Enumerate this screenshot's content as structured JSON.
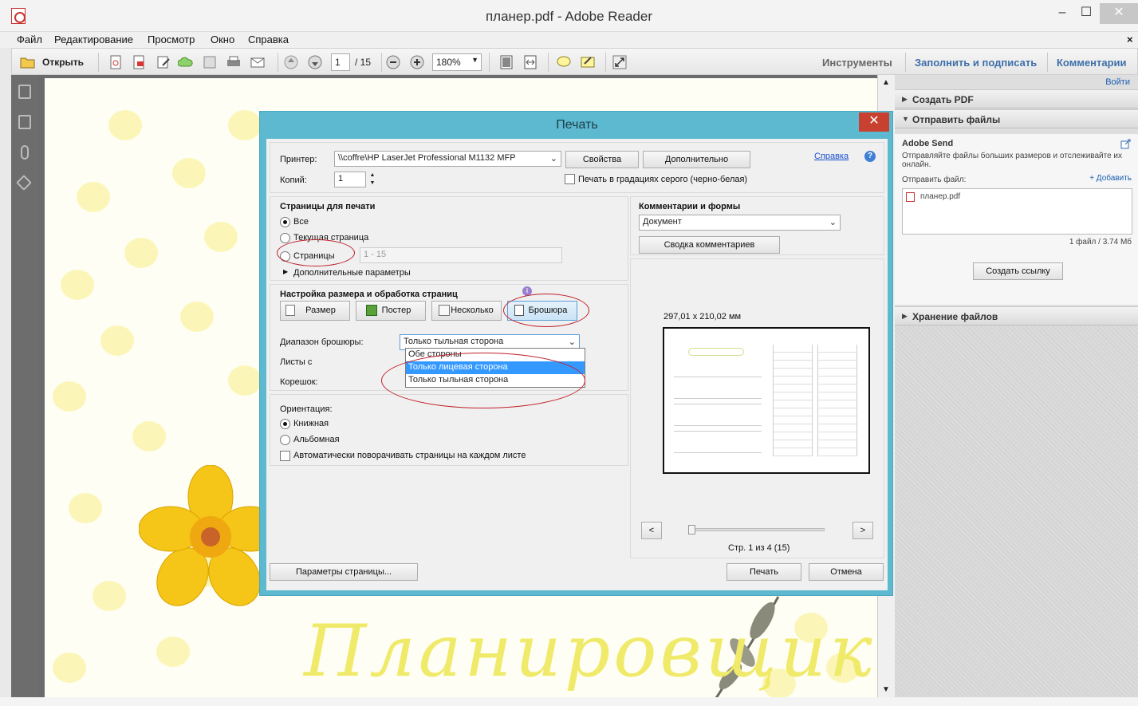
{
  "window": {
    "title": "планер.pdf - Adobe Reader",
    "minimize": "–",
    "maximize": "☐",
    "close": "✕"
  },
  "menu": [
    "Файл",
    "Редактирование",
    "Просмотр",
    "Окно",
    "Справка"
  ],
  "menu_close": "×",
  "toolbar": {
    "open_label": "Открыть",
    "page_current": "1",
    "page_total": "/ 15",
    "zoom": "180%",
    "tools": "Инструменты",
    "fill_sign": "Заполнить и подписать",
    "comments": "Комментарии"
  },
  "document": {
    "cover_word": "Планировщик"
  },
  "right_panel": {
    "login": "Войти",
    "create_pdf": "Создать PDF",
    "send_files": "Отправить файлы",
    "adobe_send_title": "Adobe Send",
    "adobe_send_desc": "Отправляйте файлы больших размеров и отслеживайте их онлайн.",
    "send_file_label": "Отправить файл:",
    "add_link": "+ Добавить",
    "file_name": "планер.pdf",
    "file_count": "1 файл / 3.74 Мб",
    "create_link_button": "Создать ссылку",
    "storage": "Хранение файлов"
  },
  "print_dialog": {
    "title": "Печать",
    "printer_label": "Принтер:",
    "printer_value": "\\\\coffre\\HP LaserJet Professional M1132 MFP",
    "properties_button": "Свойства",
    "advanced_button": "Дополнительно",
    "help_link": "Справка",
    "copies_label": "Копий:",
    "copies_value": "1",
    "grayscale_label": "Печать в градациях серого (черно-белая)",
    "pages_section": "Страницы для печати",
    "pages_all": "Все",
    "pages_current": "Текущая страница",
    "pages_range": "Страницы",
    "pages_range_value": "1 - 15",
    "more_options": "Дополнительные параметры",
    "sizing_section": "Настройка размера и обработка страниц",
    "size_button": "Размер",
    "poster_button": "Постер",
    "multiple_button": "Несколько",
    "booklet_button": "Брошюра",
    "booklet_range_label": "Диапазон брошюры:",
    "booklet_range_value": "Только тыльная сторона",
    "booklet_options": [
      "Обе стороны",
      "Только лицевая сторона",
      "Только тыльная сторона"
    ],
    "sheets_label": "Листы с",
    "binding_label": "Корешок:",
    "orientation_label": "Ориентация:",
    "portrait": "Книжная",
    "landscape": "Альбомная",
    "auto_rotate": "Автоматически поворачивать страницы на каждом листе",
    "comments_forms_label": "Комментарии и формы",
    "comments_forms_value": "Документ",
    "summary_button": "Сводка комментариев",
    "preview_size": "297,01 x 210,02 мм",
    "prev_button": "<",
    "next_button": ">",
    "page_info": "Стр. 1 из 4 (15)",
    "page_setup_button": "Параметры страницы...",
    "print_button": "Печать",
    "cancel_button": "Отмена"
  }
}
